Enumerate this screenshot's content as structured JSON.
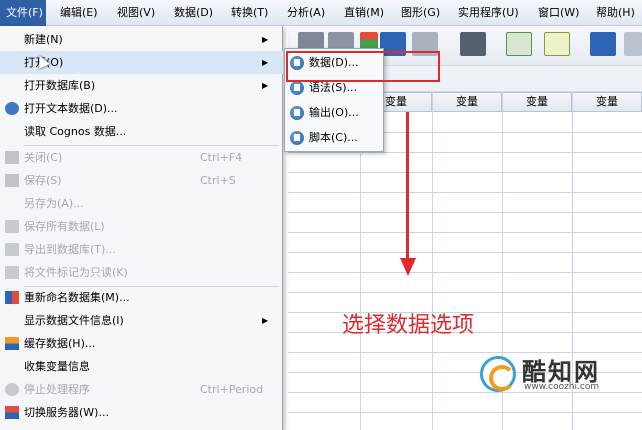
{
  "menubar": {
    "items": [
      {
        "label": "文件(F)"
      },
      {
        "label": "编辑(E)"
      },
      {
        "label": "视图(V)"
      },
      {
        "label": "数据(D)"
      },
      {
        "label": "转换(T)"
      },
      {
        "label": "分析(A)"
      },
      {
        "label": "直销(M)"
      },
      {
        "label": "图形(G)"
      },
      {
        "label": "实用程序(U)"
      },
      {
        "label": "窗口(W)"
      },
      {
        "label": "帮助(H)"
      }
    ]
  },
  "file_menu": {
    "items": [
      {
        "label": "新建(N)"
      },
      {
        "label": "打开(O)"
      },
      {
        "label": "打开数据库(B)"
      },
      {
        "label": "打开文本数据(D)..."
      },
      {
        "label": "读取 Cognos 数据..."
      },
      {
        "label": "关闭(C)",
        "shortcut": "Ctrl+F4"
      },
      {
        "label": "保存(S)",
        "shortcut": "Ctrl+S"
      },
      {
        "label": "另存为(A)..."
      },
      {
        "label": "保存所有数据(L)"
      },
      {
        "label": "导出到数据库(T)..."
      },
      {
        "label": "将文件标记为只读(K)"
      },
      {
        "label": "重新命名数据集(M)..."
      },
      {
        "label": "显示数据文件信息(I)"
      },
      {
        "label": "缓存数据(H)..."
      },
      {
        "label": "收集变量信息"
      },
      {
        "label": "停止处理程序",
        "shortcut": "Ctrl+Period"
      },
      {
        "label": "切换服务器(W)..."
      }
    ]
  },
  "open_submenu": {
    "items": [
      {
        "label": "数据(D)..."
      },
      {
        "label": "语法(S)..."
      },
      {
        "label": "输出(O)..."
      },
      {
        "label": "脚本(C)..."
      }
    ]
  },
  "grid": {
    "columns": [
      "变量",
      "变量",
      "变量",
      "变量"
    ]
  },
  "annotation": {
    "caption": "选择数据选项",
    "color": "#e0292d"
  },
  "watermark": {
    "name": "酷知网",
    "url": "www.coozhi.com"
  },
  "colors": {
    "menubar_active": "#2f5fa6",
    "menu_bg": "#f4f6f9",
    "disabled_text": "#a4aab2"
  }
}
